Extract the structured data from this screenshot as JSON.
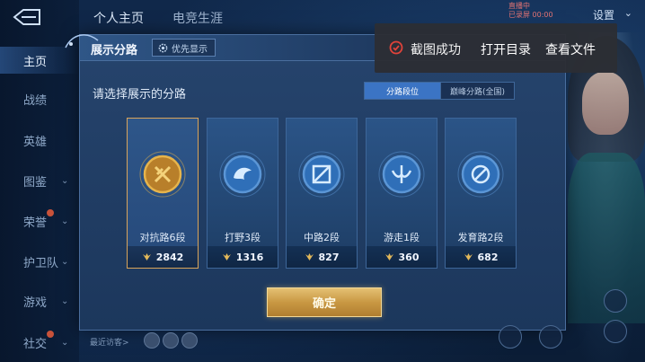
{
  "topbar": {
    "tabs": [
      "个人主页",
      "电竞生涯"
    ],
    "settings_label": "设置",
    "status_lines": [
      "直播中",
      "已录屏 00:00"
    ]
  },
  "sidebar": {
    "items": [
      {
        "label": "主页",
        "active": true,
        "chevron": false,
        "badge": false
      },
      {
        "label": "战绩",
        "active": false,
        "chevron": false,
        "badge": false
      },
      {
        "label": "英雄",
        "active": false,
        "chevron": false,
        "badge": false
      },
      {
        "label": "图鉴",
        "active": false,
        "chevron": true,
        "badge": false
      },
      {
        "label": "荣誉",
        "active": false,
        "chevron": true,
        "badge": true
      },
      {
        "label": "护卫队",
        "active": false,
        "chevron": true,
        "badge": false
      },
      {
        "label": "游戏",
        "active": false,
        "chevron": true,
        "badge": false
      },
      {
        "label": "社交",
        "active": false,
        "chevron": true,
        "badge": true
      }
    ]
  },
  "modal": {
    "title": "展示分路",
    "priority_label": "优先显示",
    "subtitle": "请选择展示的分路",
    "segments": [
      {
        "label": "分路段位",
        "active": true
      },
      {
        "label": "巅峰分路(全国)",
        "active": false
      }
    ],
    "cards": [
      {
        "label": "对抗路6段",
        "score": "2842",
        "selected": true,
        "tier": "gold"
      },
      {
        "label": "打野3段",
        "score": "1316",
        "selected": false,
        "tier": "blue"
      },
      {
        "label": "中路2段",
        "score": "827",
        "selected": false,
        "tier": "blue"
      },
      {
        "label": "游走1段",
        "score": "360",
        "selected": false,
        "tier": "blue"
      },
      {
        "label": "发育路2段",
        "score": "682",
        "selected": false,
        "tier": "blue"
      }
    ],
    "confirm_label": "确定"
  },
  "bottom": {
    "visitors_label": "最近访客>"
  },
  "toast": {
    "message": "截图成功",
    "open_dir_label": "打开目录",
    "view_file_label": "查看文件"
  },
  "colors": {
    "accent_gold": "#d9a45a",
    "segment_active": "#3b74c4",
    "toast_icon": "#e0433a"
  }
}
